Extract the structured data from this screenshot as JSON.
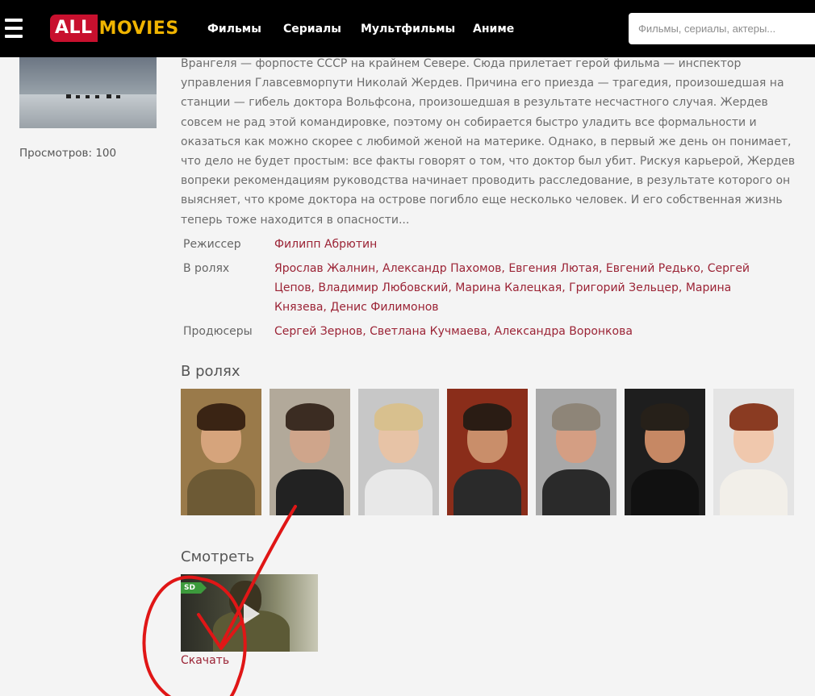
{
  "header": {
    "logo_part1": "ALL",
    "logo_part2": "MOVIES",
    "nav": [
      "Фильмы",
      "Сериалы",
      "Мультфильмы",
      "Аниме"
    ],
    "search_placeholder": "Фильмы, сериалы, актеры..."
  },
  "sidebar": {
    "views": "Просмотров: 100"
  },
  "description": "Врангеля — форпосте СССР на крайнем Севере. Сюда прилетает герой фильма — инспектор управления Главсевморпути Николай Жердев. Причина его приезда — трагедия, произошедшая на станции — гибель доктора Вольфсона, произошедшая в результате несчастного случая. Жердев совсем не рад этой командировке, поэтому он собирается быстро уладить все формальности и оказаться как можно скорее с любимой женой на материке. Однако, в первый же день он понимает, что дело не будет простым: все факты говорят о том, что доктор был убит. Рискуя карьерой, Жердев вопреки рекомендациям руководства начинает проводить расследование, в результате которого он выясняет, что кроме доктора на острове погибло еще несколько человек. И его собственная жизнь теперь тоже находится в опасности...",
  "credits": [
    {
      "label": "Режиссер",
      "names": [
        "Филипп Абрютин"
      ]
    },
    {
      "label": "В ролях",
      "names": [
        "Ярослав Жалнин",
        "Александр Пахомов",
        "Евгения Лютая",
        "Евгений Редько",
        "Сергей Цепов",
        "Владимир Любовский",
        "Марина Калецкая",
        "Григорий Зельцер",
        "Марина Князева",
        "Денис Филимонов"
      ]
    },
    {
      "label": "Продюсеры",
      "names": [
        "Сергей Зернов",
        "Светлана Кучмаева",
        "Александра Воронкова"
      ]
    }
  ],
  "cast_section_title": "В ролях",
  "watch_section_title": "Смотреть",
  "video": {
    "quality_badge": "SD",
    "download_label": "Скачать"
  }
}
